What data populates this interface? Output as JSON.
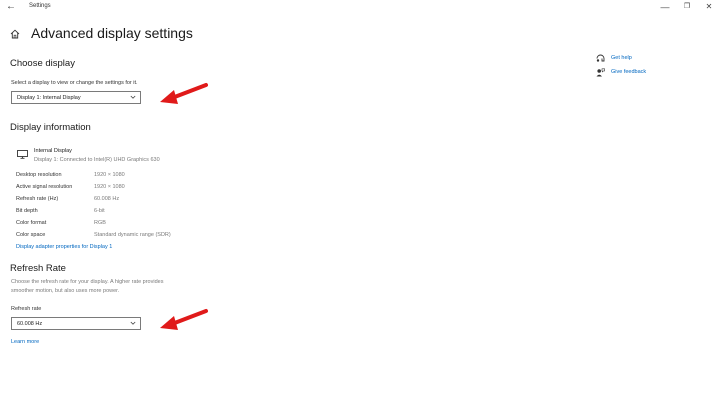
{
  "window": {
    "title": "Settings",
    "back_glyph": "←",
    "minimize_glyph": "—",
    "maximize_glyph": "❐",
    "close_glyph": "✕"
  },
  "page": {
    "title": "Advanced display settings"
  },
  "choose_display": {
    "heading": "Choose display",
    "instruction": "Select a display to view or change the settings for it.",
    "dropdown_value": "Display 1: Internal Display"
  },
  "display_info": {
    "heading": "Display information",
    "monitor_name": "Internal Display",
    "monitor_sub": "Display 1: Connected to Intel(R) UHD Graphics 630",
    "rows": [
      {
        "label": "Desktop resolution",
        "value": "1920 × 1080"
      },
      {
        "label": "Active signal resolution",
        "value": "1920 × 1080"
      },
      {
        "label": "Refresh rate (Hz)",
        "value": "60.008 Hz"
      },
      {
        "label": "Bit depth",
        "value": "6-bit"
      },
      {
        "label": "Color format",
        "value": "RGB"
      },
      {
        "label": "Color space",
        "value": "Standard dynamic range (SDR)"
      }
    ],
    "adapter_link": "Display adapter properties for Display 1"
  },
  "refresh_rate": {
    "heading": "Refresh Rate",
    "description_line1": "Choose the refresh rate for your display. A higher rate provides",
    "description_line2": "smoother motion, but also uses more power.",
    "field_label": "Refresh rate",
    "dropdown_value": "60.008 Hz",
    "learn_more": "Learn more"
  },
  "help": {
    "get_help": "Get help",
    "give_feedback": "Give feedback"
  },
  "colors": {
    "accent": "#0067c0",
    "annotation_arrow": "#e01a1a"
  }
}
